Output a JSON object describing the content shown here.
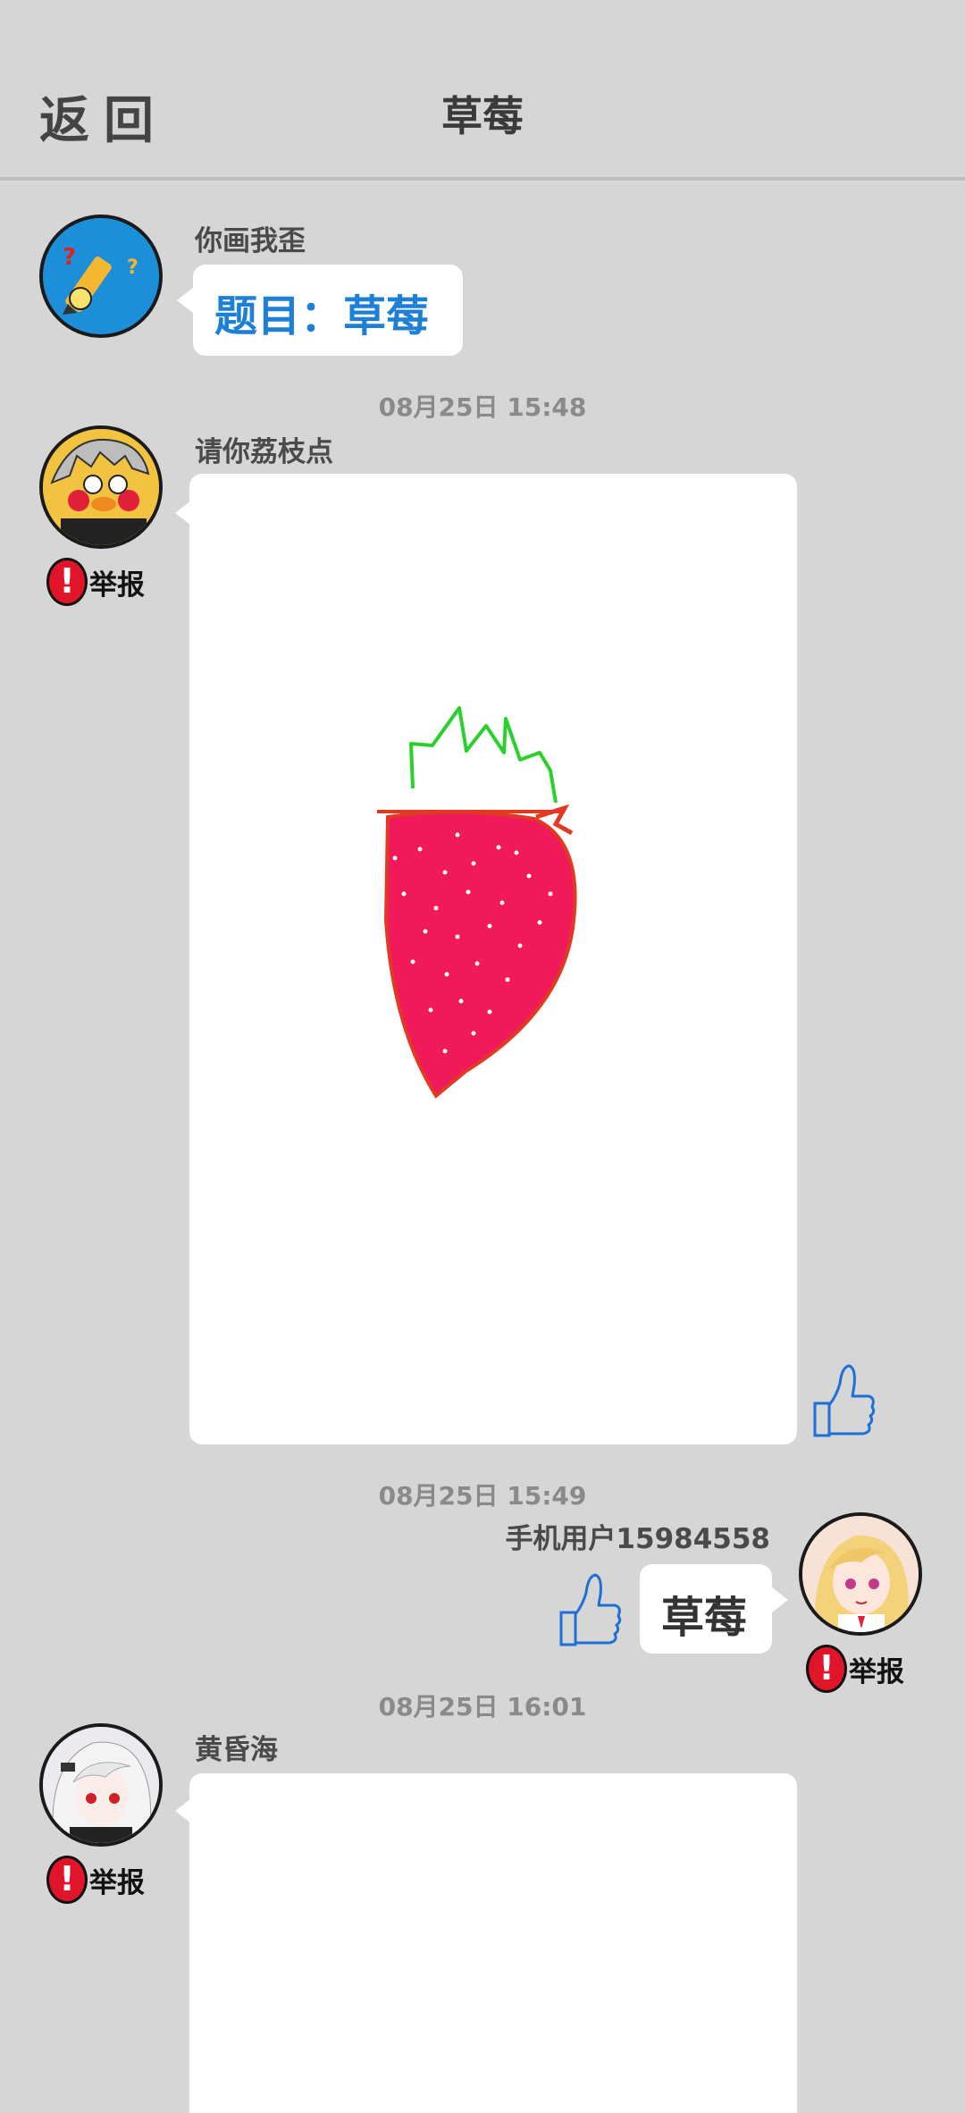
{
  "header": {
    "back_label": "返回",
    "title": "草莓"
  },
  "messages": [
    {
      "user": "你画我歪",
      "text": "题目：草莓"
    },
    {
      "timestamp": "08月25日  15:48",
      "user": "请你荔枝点",
      "report_label": "举报"
    },
    {
      "timestamp": "08月25日  15:49",
      "user": "手机用户15984558",
      "text": "草莓",
      "report_label": "举报"
    },
    {
      "timestamp": "08月25日  16:01",
      "user": "黄昏海",
      "report_label": "举报"
    }
  ],
  "colors": {
    "background": "#d6d6d6",
    "topic_text": "#1e7fd6",
    "thumb": "#1e6fd6",
    "report_badge": "#e0152a",
    "strawberry": "#f0195a",
    "leaves": "#2bd12b"
  },
  "icons": [
    "thumbs-up-icon",
    "report-alert-icon"
  ]
}
